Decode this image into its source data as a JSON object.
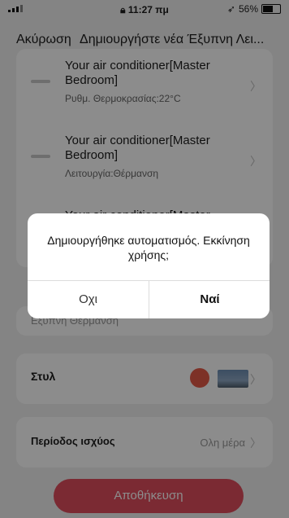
{
  "status_bar": {
    "time": "11:27 πμ",
    "battery": "56%"
  },
  "nav": {
    "cancel": "Ακύρωση",
    "title": "Δημιουργήστε νέα Έξυπνη Λει..."
  },
  "actions": [
    {
      "name": "Your air conditioner[Master Bedroom]",
      "detail": "Ρυθμ. Θερμοκρασίας:22°C"
    },
    {
      "name": "Your air conditioner[Master Bedroom]",
      "detail": "Λειτουργία:Θέρμανση"
    },
    {
      "name": "Your air conditioner[Master",
      "detail": ""
    }
  ],
  "scene_name": "Εξυπνη Θερμανση",
  "style": {
    "label": "Στυλ",
    "color": "#e45a48"
  },
  "period": {
    "label": "Περίοδος ισχύος",
    "value": "Ολη μέρα"
  },
  "save_button": "Αποθήκευση",
  "dialog": {
    "message": "Δημιουργήθηκε αυτοματισμός. Εκκίνηση χρήσης;",
    "no": "Οχι",
    "yes": "Ναί"
  }
}
